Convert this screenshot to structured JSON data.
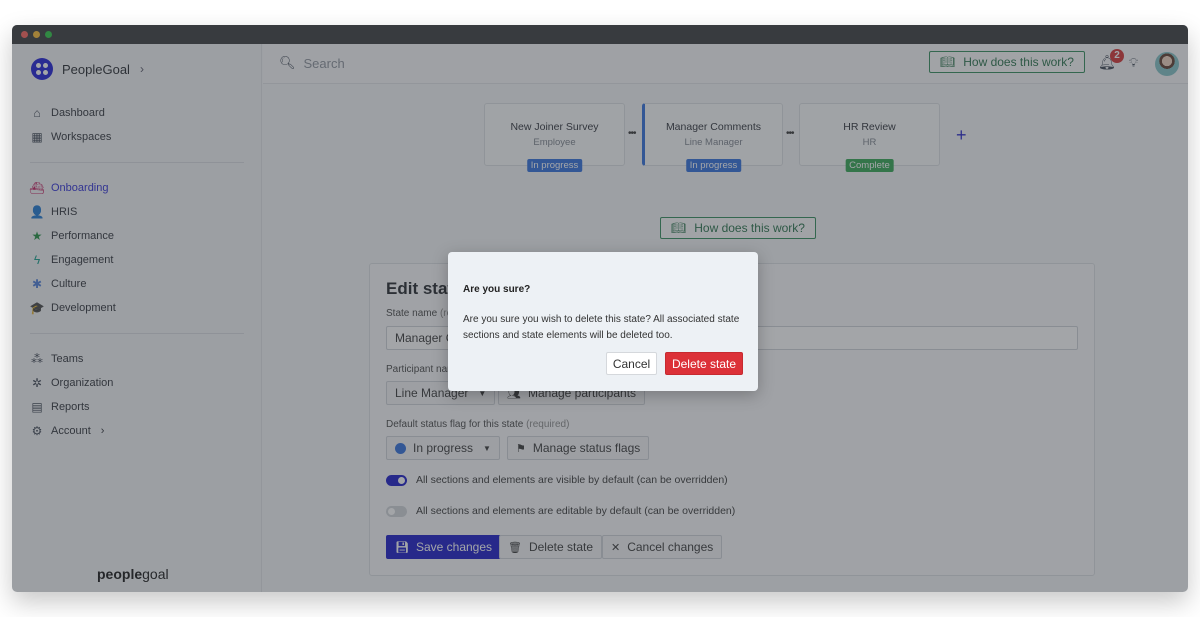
{
  "window": {
    "title": "PeopleGoal"
  },
  "brand": {
    "name": "PeopleGoal",
    "chevron": "›",
    "footer_bold": "people",
    "footer_light": "goal"
  },
  "sidebar": {
    "top_items": [
      {
        "label": "Dashboard",
        "icon": "home-icon"
      },
      {
        "label": "Workspaces",
        "icon": "grid-icon"
      }
    ],
    "module_items": [
      {
        "label": "Onboarding",
        "icon": "ship-icon",
        "color": "#c2185b",
        "active": true
      },
      {
        "label": "HRIS",
        "icon": "user-edit-icon",
        "color": "#d4a017"
      },
      {
        "label": "Performance",
        "icon": "star-icon",
        "color": "#1e8e3e"
      },
      {
        "label": "Engagement",
        "icon": "bolt-icon",
        "color": "#0f9d8a"
      },
      {
        "label": "Culture",
        "icon": "asterisk-icon",
        "color": "#4a7bd8"
      },
      {
        "label": "Development",
        "icon": "graduation-cap-icon",
        "color": "#a05bb5"
      }
    ],
    "admin_items": [
      {
        "label": "Teams",
        "icon": "sitemap-icon"
      },
      {
        "label": "Organization",
        "icon": "network-icon"
      },
      {
        "label": "Reports",
        "icon": "table-icon"
      },
      {
        "label": "Account",
        "icon": "gear-icon",
        "chevron": "›"
      }
    ]
  },
  "topbar": {
    "search_placeholder": "Search",
    "help_label": "How does this work?",
    "notification_count": "2"
  },
  "workflow": {
    "stages": [
      {
        "name": "New Joiner Survey",
        "role": "Employee",
        "flag": "In progress",
        "flag_color": "#2d6ddb",
        "active": false
      },
      {
        "name": "Manager Comments",
        "role": "Line Manager",
        "flag": "In progress",
        "flag_color": "#2d6ddb",
        "active": true
      },
      {
        "name": "HR Review",
        "role": "HR",
        "flag": "Complete",
        "flag_color": "#2ea44f",
        "active": false
      }
    ],
    "add_label": "+",
    "help_label": "How does this work?"
  },
  "edit_state": {
    "title": "Edit state",
    "state_name_label": "State name",
    "state_name_required": "(required)",
    "state_name_value": "Manager Comments",
    "participant_label": "Participant name",
    "participant_value": "Line Manager",
    "manage_participants_label": "Manage participants",
    "status_flag_label": "Default status flag for this state",
    "status_flag_required": "(required)",
    "status_flag_value": "In progress",
    "manage_status_flags_label": "Manage status flags",
    "visible_toggle": {
      "label": "All sections and elements are visible by default (can be overridden)",
      "on": true
    },
    "editable_toggle": {
      "label": "All sections and elements are editable by default (can be overridden)",
      "on": false
    },
    "save_label": "Save changes",
    "delete_label": "Delete state",
    "cancel_label": "Cancel changes"
  },
  "modal": {
    "title": "Are you sure?",
    "body": "Are you sure you wish to delete this state? All associated state sections and state elements will be deleted too.",
    "cancel_label": "Cancel",
    "confirm_label": "Delete state"
  }
}
